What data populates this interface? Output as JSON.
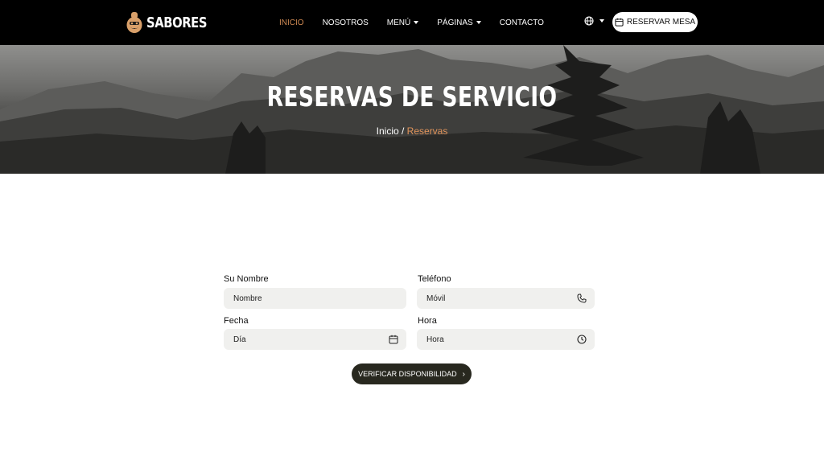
{
  "brand": {
    "name": "SABORES"
  },
  "nav": {
    "items": [
      {
        "label": "Inicio",
        "active": true,
        "dropdown": false
      },
      {
        "label": "Nosotros",
        "active": false,
        "dropdown": false
      },
      {
        "label": "Menú",
        "active": false,
        "dropdown": true
      },
      {
        "label": "Páginas",
        "active": false,
        "dropdown": true
      },
      {
        "label": "Contacto",
        "active": false,
        "dropdown": false
      }
    ],
    "language_icon": "globe-icon",
    "reserve_button": "Reservar Mesa"
  },
  "hero": {
    "title": "Reservas de Servicio",
    "breadcrumb": {
      "home": "Inicio",
      "separator": " / ",
      "current": "Reservas"
    }
  },
  "form": {
    "name": {
      "label": "Su Nombre",
      "placeholder": "Nombre"
    },
    "phone": {
      "label": "Teléfono",
      "placeholder": "Móvil",
      "icon": "phone-icon"
    },
    "date": {
      "label": "Fecha",
      "placeholder": "Día",
      "icon": "calendar-icon"
    },
    "time": {
      "label": "Hora",
      "placeholder": "Hora",
      "icon": "clock-icon"
    },
    "submit": "Verificar Disponibilidad"
  },
  "colors": {
    "accent": "#d08a53",
    "nav_bg": "#000000",
    "field_bg": "#f0f0ee",
    "button_dark": "#28281f"
  }
}
